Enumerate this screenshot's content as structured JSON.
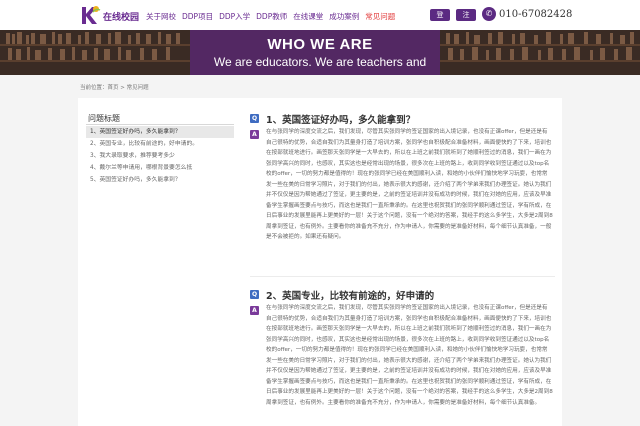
{
  "header": {
    "logo_text": "在线校园",
    "nav": [
      "关于网校",
      "DDP项目",
      "DDP入学",
      "DDP教师",
      "在线课堂",
      "成功案例",
      "常见问题"
    ],
    "active_nav_index": 6,
    "login_label": "登录",
    "register_label": "注册",
    "phone": "010-67082428",
    "phone_icon": "phone-icon"
  },
  "banner": {
    "title": "WHO WE ARE",
    "subtitle": "We are educators. We are teachers and"
  },
  "breadcrumb": "当前位置：首页 > 常见问题",
  "sidebar": {
    "title": "问题标题",
    "items": [
      {
        "label": "1、英国签证好办吗，多久能拿到？",
        "active": true
      },
      {
        "label": "2、英国专业，比较有前途的，好申请的。",
        "active": false
      },
      {
        "label": "3、我大录取要求，推荐要考多少",
        "active": false
      },
      {
        "label": "4、戴尔兰等申请用，哪根背景要怎么抵",
        "active": false
      },
      {
        "label": "5、英国签证好办吗，多久能拿到？",
        "active": false
      }
    ]
  },
  "qa": [
    {
      "q_badge": "Q",
      "a_badge": "A",
      "question": "1、英国签证好办吗，多久能拿到？",
      "answer": "在与张同学的深度交流之后，我们发现，尽管其实张同学的签证国家的出入境记录，也没有正课offer，但是还是有自己很特的优势，合适自我们为其量身打造了培训方案，张同学也自积极配合准备材料，画面便快的了下来，培训也在按部就班地进行。画签那天张同学是一大早去的，所以在上班之前我们就听到了她顺利签过的消息，我们一画在为张同学高兴的同时，也感叹，其实这也是经常出现的场景，很多次在上班的路上，收到同学收到签证通过以及top名校的offer，一切的努力都是值得的！现在的张同学已经在美国顺利入读，和她的小伙伴们愉快地学习玩耍，也常常发一些在美的日常学习照片，对于我们的付出，她表示很大的感谢，还介绍了两个学弟来我们办理签证。她认为我们并不仅仅是因为帮她通过了签证，更主要的是，之前的签证培训并没有成功的时候，我们在对她的应用，应该及早准备学生掌握画签要点与技巧，而这也是我们一直所秉承的。在这里也祝贺我们的张同学顺利通过签证，学有所成，在日后事业的发展里能再上更美好的一层！关于这个问题，没有一个绝对的答案，我经手的这么多学生，大多是2周到8周拿到签证，也有例外。主要看你的准备充不充分，作为申请人，你需要的是准备好材料，每个细节认真准备，一般是不会被拒的。如果还有疑问。"
    },
    {
      "q_badge": "Q",
      "a_badge": "A",
      "question": "2、英国专业，比较有前途的，好申请的",
      "answer": "在与张同学的深度交流之后，我们发现，尽管其实张同学的签证国家的出入境记录，也没有正课offer，但是还是有自己很特的优势，合适自我们为其量身打造了培训方案，张同学也自积极配合准备材料，画面便快的了下来，培训也在按部就班地进行。画签那天张同学是一大早去的，所以在上班之前我们就听到了她顺利签过的消息，我们一画在为张同学高兴的同时，也感叹，其实这也是经常出现的场景，很多次在上班的路上，收到同学收到签证通过以及top名校的offer，一切的努力都是值得的！现在的张同学已经在美国顺利入读，和她的小伙伴们愉快地学习玩耍，也常常发一些在美的日常学习照片，对于我们的付出，她表示很大的感谢，还介绍了两个学弟来我们办理签证。她认为我们并不仅仅是因为帮她通过了签证，更主要的是，之前的签证培训并没有成功的时候，我们在对她的应用，应该及早准备学生掌握画签要点与技巧，而这也是我们一直所秉承的。在这里也祝贺我们的张同学顺利通过签证，学有所成，在日后事业的发展里能再上更美好的一层！关于这个问题，没有一个绝对的答案，我经手的这么多学生，大多是2周到8周拿到签证，也有例外。主要看你的准备充不充分，作为申请人，你需要的是准备好材料，每个细节认真准备。"
    }
  ],
  "colors": {
    "brand_purple": "#5b2a82",
    "active_nav": "#e23a3a",
    "q_badge": "#3f6cc1",
    "a_badge": "#7a3a9a"
  }
}
